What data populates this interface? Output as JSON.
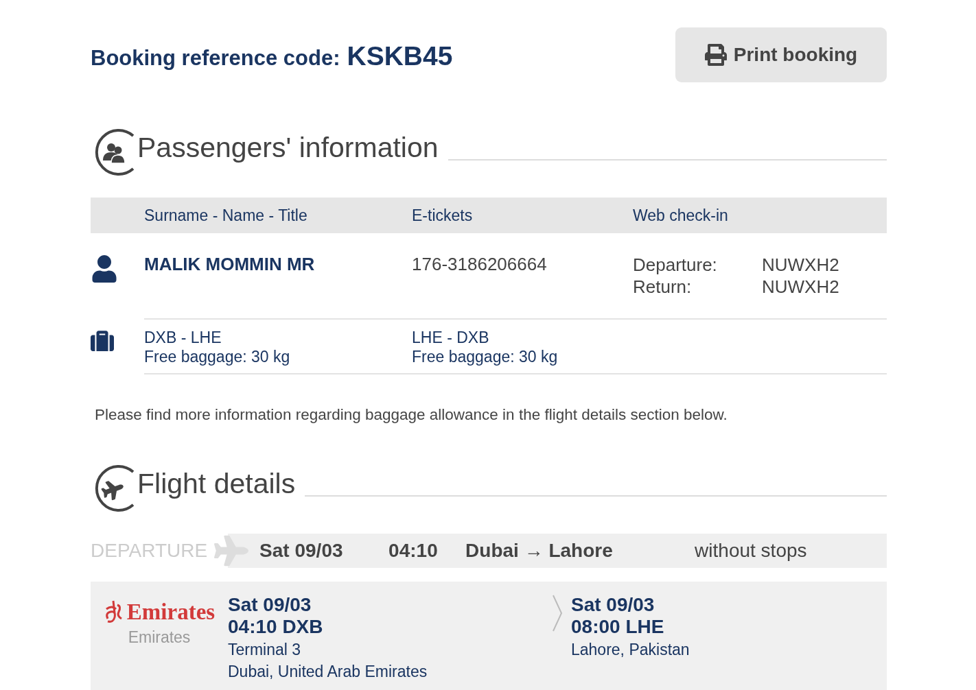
{
  "booking": {
    "label": "Booking reference code:",
    "code": "KSKB45"
  },
  "print_button": {
    "label": "Print booking"
  },
  "passengers_section": {
    "title": "Passengers' information",
    "columns": [
      "Surname - Name - Title",
      "E-tickets",
      "Web check-in"
    ],
    "passengers": [
      {
        "name": "MALIK MOMMIN MR",
        "eticket": "176-3186206664",
        "checkin": [
          {
            "label": "Departure:",
            "code": "NUWXH2"
          },
          {
            "label": "Return:",
            "code": "NUWXH2"
          }
        ],
        "baggage": [
          {
            "route": "DXB - LHE",
            "allowance": "Free baggage: 30 kg"
          },
          {
            "route": "LHE - DXB",
            "allowance": "Free baggage: 30 kg"
          }
        ]
      }
    ],
    "note": "Please find more information regarding baggage allowance in the flight details section below."
  },
  "flight_section": {
    "title": "Flight details",
    "legs": [
      {
        "kind": "departure",
        "label": "DEPARTURE",
        "date": "Sat 09/03",
        "time": "04:10",
        "route": "Dubai → Lahore",
        "stops": "without stops",
        "segments": [
          {
            "airline_logo": "Emirates",
            "airline": "Emirates",
            "departure": {
              "date": "Sat 09/03",
              "time_airport": "04:10 DXB",
              "terminal": "Terminal 3",
              "city": "Dubai, United Arab Emirates"
            },
            "arrival": {
              "date": "Sat 09/03",
              "time_airport": "08:00 LHE",
              "city": "Lahore, Pakistan"
            }
          }
        ]
      }
    ]
  }
}
